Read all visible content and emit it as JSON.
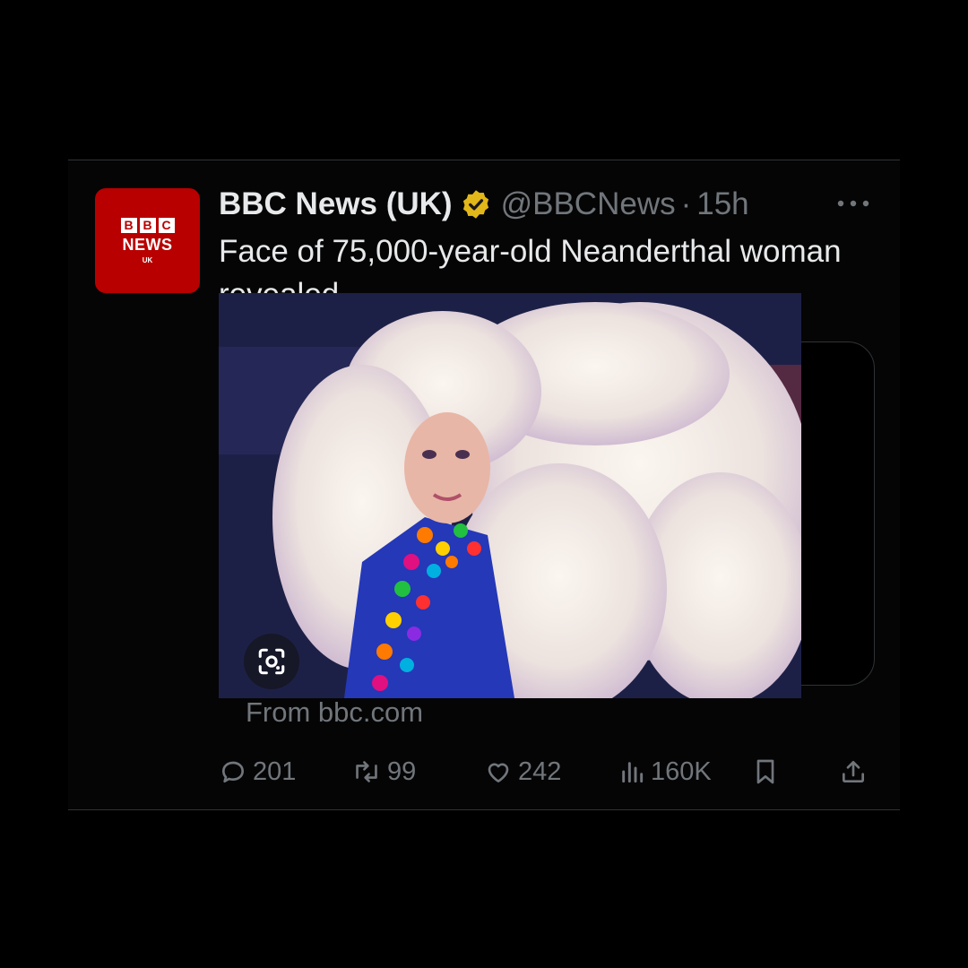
{
  "tweet": {
    "display_name": "BBC News (UK)",
    "handle": "@BBCNews",
    "separator": "·",
    "time": "15h",
    "text": "Face of 75,000-year-old Neanderthal woman revealed",
    "avatar": {
      "blocks": [
        "B",
        "B",
        "C"
      ],
      "news": "NEWS",
      "uk": "UK"
    },
    "card_source": "From bbc.com",
    "stats": {
      "replies": "201",
      "reposts": "99",
      "likes": "242",
      "views": "160K"
    },
    "icons": {
      "verified": "verified-badge-icon",
      "more": "more-icon",
      "reply": "reply-icon",
      "repost": "repost-icon",
      "like": "like-icon",
      "views": "views-icon",
      "bookmark": "bookmark-icon",
      "share": "share-icon",
      "lens": "lens-icon"
    },
    "colors": {
      "background": "#000000",
      "text": "#e7e9ea",
      "secondary": "#71767b",
      "brand": "#b80000",
      "verified": "#e2b719"
    }
  }
}
